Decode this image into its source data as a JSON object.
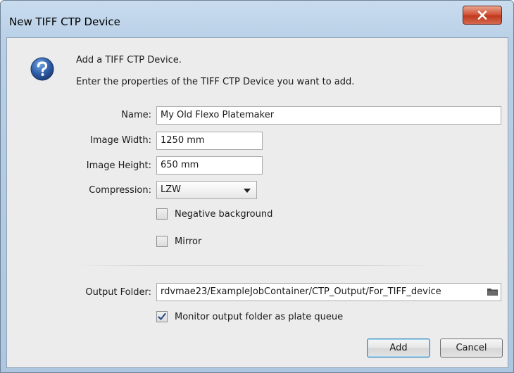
{
  "window": {
    "title": "New TIFF CTP Device",
    "close_glyph": "X"
  },
  "header": {
    "icon": "help-question-icon",
    "line1": "Add a TIFF CTP Device.",
    "line2": "Enter the properties of the TIFF CTP Device you want to add."
  },
  "form": {
    "name_label": "Name:",
    "name_value": "My Old Flexo Platemaker",
    "width_label": "Image Width:",
    "width_value": "1250 mm",
    "height_label": "Image Height:",
    "height_value": "650 mm",
    "compression_label": "Compression:",
    "compression_value": "LZW",
    "negative_label": "Negative background",
    "negative_checked": false,
    "mirror_label": "Mirror",
    "mirror_checked": false,
    "output_label": "Output Folder:",
    "output_value": "rdvmae23/ExampleJobContainer/CTP_Output/For_TIFF_device",
    "monitor_label": "Monitor output folder as plate queue",
    "monitor_checked": true
  },
  "buttons": {
    "add": "Add",
    "cancel": "Cancel"
  },
  "colors": {
    "title_bar": "#b8cfe6",
    "close_button": "#c9432a",
    "dialog_body": "#ececec",
    "help_icon": "#2f5fa8",
    "default_button_border": "#3c7fb1"
  }
}
